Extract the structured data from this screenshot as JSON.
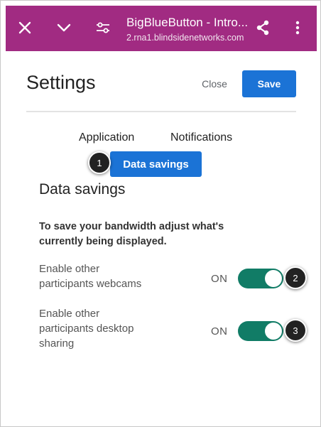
{
  "topbar": {
    "title": "BigBlueButton - Intro...",
    "subtitle": "2.rna1.blindsidenetworks.com",
    "icons": [
      "close-icon",
      "chevron-down-icon",
      "tune-icon",
      "share-icon",
      "more-vertical-icon"
    ]
  },
  "settings": {
    "title": "Settings",
    "close_label": "Close",
    "save_label": "Save"
  },
  "tabs": [
    {
      "label": "Application"
    },
    {
      "label": "Notifications"
    },
    {
      "label": "Data savings",
      "active": true
    }
  ],
  "data_savings": {
    "title": "Data savings",
    "description": "To save your bandwidth adjust what's currently being displayed.",
    "options": [
      {
        "label": "Enable other participants webcams",
        "state": "ON",
        "enabled": true
      },
      {
        "label": "Enable other participants desktop sharing",
        "state": "ON",
        "enabled": true
      }
    ]
  },
  "callouts": [
    "1",
    "2",
    "3"
  ],
  "colors": {
    "topbar": "#a12b82",
    "primary": "#1b73d6",
    "toggle_on": "#117c66"
  }
}
